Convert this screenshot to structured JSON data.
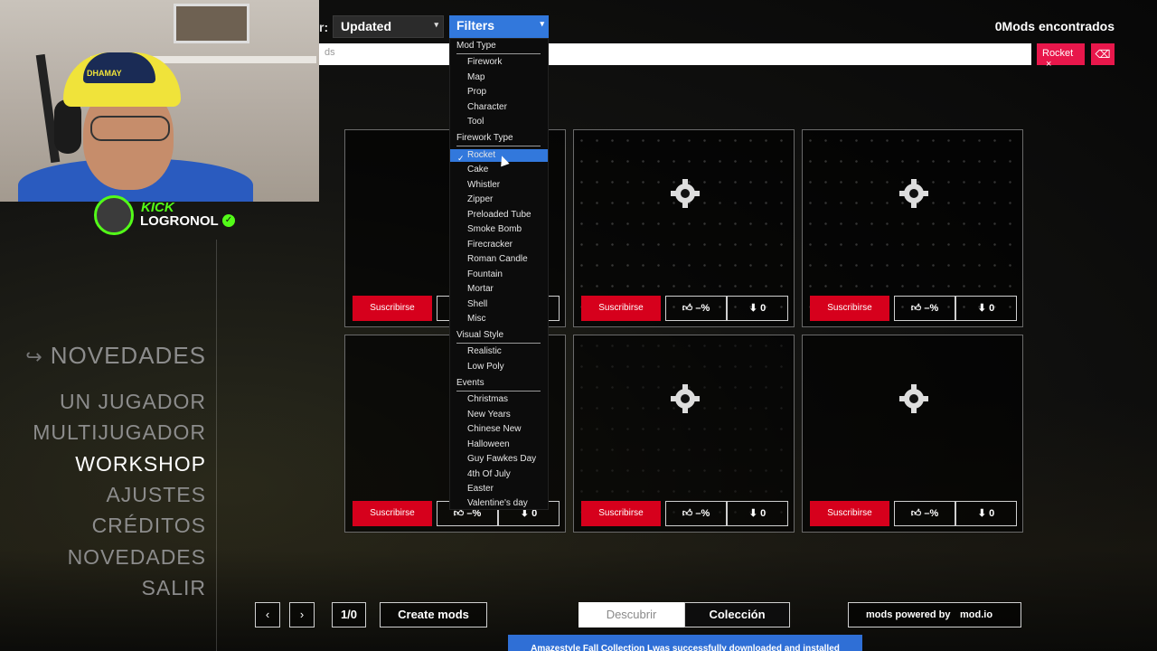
{
  "header": {
    "sort_label": "r:",
    "sort_value": "Updated",
    "filters_label": "Filters",
    "mods_found": "0Mods encontrados",
    "search_placeholder": "ds",
    "chip_label": "Rocket",
    "chip_remove_glyph": "×",
    "clear_glyph": "⌫"
  },
  "stream": {
    "platform": "KICK",
    "channel": "LOGRONOL",
    "cap_text": "DHAMAY"
  },
  "nav": {
    "title": "NOVEDADES",
    "items": [
      {
        "label": "UN JUGADOR",
        "active": false
      },
      {
        "label": "MULTIJUGADOR",
        "active": false
      },
      {
        "label": "WORKSHOP",
        "active": true
      },
      {
        "label": "AJUSTES",
        "active": false
      },
      {
        "label": "CRÉDITOS",
        "active": false
      },
      {
        "label": "NOVEDADES",
        "active": false
      },
      {
        "label": "SALIR",
        "active": false
      }
    ]
  },
  "cards": {
    "subscribe_label": "Suscribirse",
    "like_value": "–%",
    "download_value": "0",
    "icons": {
      "like": "thumbs-up-icon",
      "download": "download-icon",
      "placeholder": "gear-icon"
    }
  },
  "filters_menu": {
    "sections": [
      {
        "header": "Mod Type",
        "items": [
          "Firework",
          "Map",
          "Prop",
          "Character",
          "Tool"
        ]
      },
      {
        "header": "Firework Type",
        "items": [
          "Rocket",
          "Cake",
          "Whistler",
          "Zipper",
          "Preloaded Tube",
          "Smoke Bomb",
          "Firecracker",
          "Roman Candle",
          "Fountain",
          "Mortar",
          "Shell",
          "Misc"
        ]
      },
      {
        "header": "Visual Style",
        "items": [
          "Realistic",
          "Low Poly"
        ]
      },
      {
        "header": "Events",
        "items": [
          "Christmas",
          "New Years",
          "Chinese New",
          "Halloween",
          "Guy Fawkes Day",
          "4th Of July",
          "Easter",
          "Valentine's day"
        ]
      }
    ],
    "selected": "Rocket",
    "check_glyph": "✓"
  },
  "footer": {
    "prev_glyph": "‹",
    "next_glyph": "›",
    "page_indicator": "1/0",
    "create_label": "Create mods",
    "discover_label": "Descubrir",
    "collection_label": "Colección",
    "powered_label": "mods powered by",
    "modio_label": "mod.io",
    "toast": "Amazestyle Fall Collection Lwas successfully downloaded and installed"
  },
  "colors": {
    "accent_blue": "#3278dc",
    "subscribe_red": "#d6001c",
    "chip_pink": "#e8174b",
    "kick_green": "#53fc18"
  }
}
